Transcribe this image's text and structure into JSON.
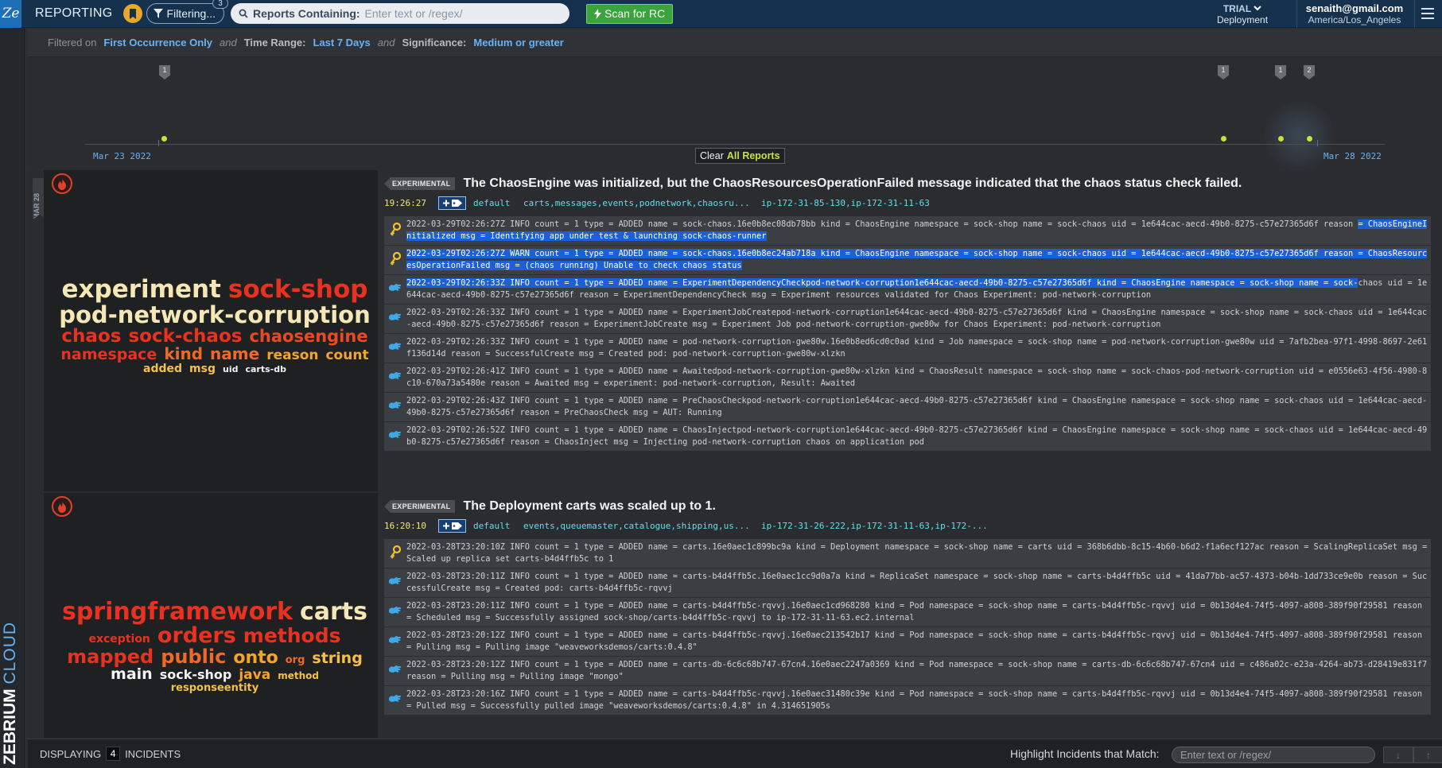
{
  "header": {
    "logo": "Ze",
    "title": "REPORTING",
    "filter_label": "Filtering...",
    "filter_count": "3",
    "search_label": "Reports Containing:",
    "search_placeholder": "Enter text or /regex/",
    "scan_label": "Scan for RC",
    "plan": "TRIAL",
    "deployment": "Deployment",
    "email": "senaith@gmail.com",
    "timezone": "America/Los_Angeles"
  },
  "brand": {
    "bold": "ZEBRIUM",
    "light": "CLOUD"
  },
  "filters": {
    "prefix": "Filtered on",
    "occurrence": "First Occurrence Only",
    "and1": "and",
    "time_key": "Time Range:",
    "time_val": "Last 7 Days",
    "and2": "and",
    "sig_key": "Significance:",
    "sig_val": "Medium or greater"
  },
  "timeline": {
    "start_date": "Mar 23 2022",
    "end_date": "Mar 28 2022",
    "clear_prefix": "Clear",
    "clear_accent": "All Reports",
    "pins": [
      "1",
      "1",
      "1",
      "2"
    ]
  },
  "day_marker": "MAR 28",
  "incidents": [
    {
      "badge": "EXPERIMENTAL",
      "title": "The ChaosEngine was initialized, but the ChaosResourcesOperationFailed message indicated that the chaos status check failed.",
      "time": "19:26:27",
      "namespace": "default",
      "apps": "carts,messages,events,podnetwork,chaosru...",
      "hosts": "ip-172-31-85-130,ip-172-31-11-63",
      "wordcloud": [
        [
          {
            "w": "experiment",
            "c": "#f6e7b6",
            "s": 31
          },
          {
            "w": "sock-shop",
            "c": "#e8321f",
            "s": 31
          }
        ],
        [
          {
            "w": "pod-network-corruption",
            "c": "#f6e7b6",
            "s": 29
          }
        ],
        [
          {
            "w": "chaos",
            "c": "#e8321f",
            "s": 23
          },
          {
            "w": "sock-chaos",
            "c": "#e8321f",
            "s": 23
          },
          {
            "w": "chaosengine",
            "c": "#e84a24",
            "s": 21
          }
        ],
        [
          {
            "w": "namespace",
            "c": "#e8321f",
            "s": 19
          },
          {
            "w": "kind",
            "c": "#ee6a26",
            "s": 20
          },
          {
            "w": "name",
            "c": "#ee6a26",
            "s": 20
          },
          {
            "w": "reason",
            "c": "#f4a62a",
            "s": 17
          },
          {
            "w": "count",
            "c": "#f4a62a",
            "s": 17
          }
        ],
        [
          {
            "w": "added",
            "c": "#f4c04a",
            "s": 14
          },
          {
            "w": "msg",
            "c": "#f4c04a",
            "s": 14
          },
          {
            "w": "uid",
            "c": "#f3f3f3",
            "s": 11
          },
          {
            "w": "carts-db",
            "c": "#f3f3f3",
            "s": 11
          }
        ]
      ],
      "logs": [
        {
          "icon": "key",
          "text": "2022-03-29T02:26:27Z INFO count = 1 type = ADDED name = sock-chaos.16e0b8ec08db78bb kind = ChaosEngine namespace = sock-shop name = sock-chaos uid = 1e644cac-aecd-49b0-8275-c57e27365d6f reason ",
          "hl": "= ChaosEngineInitialized msg = Identifying app under test & launching sock-chaos-runner"
        },
        {
          "icon": "key",
          "text": "2022-03-29T02:26:27Z WARN count = 1 type = ADDED name = sock-chaos.16e0b8ec24ab718a kind = ChaosEngine namespace = sock-shop name = sock-chaos uid = 1e644cac-aecd-49b0-8275-c57e27365d6f reason ",
          "hl": "= ChaosResourcesOperationFailed msg = (chaos running) Unable to check chaos status",
          "all_hl": true
        },
        {
          "icon": "hand",
          "text": "chaos uid = 1e644cac-aecd-49b0-8275-c57e27365d6f reason = ExperimentDependencyCheck msg = Experiment resources validated for Chaos Experiment: pod-network-corruption",
          "lead_hl": "2022-03-29T02:26:33Z INFO count = 1 type = ADDED name = ExperimentDependencyCheckpod-network-corruption1e644cac-aecd-49b0-8275-c57e27365d6f kind = ChaosEngine namespace = sock-shop name = sock-"
        },
        {
          "icon": "hand",
          "text": "2022-03-29T02:26:33Z INFO count = 1 type = ADDED name = ExperimentJobCreatepod-network-corruption1e644cac-aecd-49b0-8275-c57e27365d6f kind = ChaosEngine namespace = sock-shop name = sock-chaos uid = 1e644cac-aecd-49b0-8275-c57e27365d6f reason = ExperimentJobCreate msg = Experiment Job pod-network-corruption-gwe80w for Chaos Experiment: pod-network-corruption"
        },
        {
          "icon": "hand",
          "text": "2022-03-29T02:26:33Z INFO count = 1 type = ADDED name = pod-network-corruption-gwe80w.16e0b8ed6cd0c0ad kind = Job namespace = sock-shop name = pod-network-corruption-gwe80w uid = 7afb2bea-97f1-4998-8697-2e61f136d14d reason = SuccessfulCreate msg = Created pod: pod-network-corruption-gwe80w-xlzkn"
        },
        {
          "icon": "hand",
          "text": "2022-03-29T02:26:41Z INFO count = 1 type = ADDED name = Awaitedpod-network-corruption-gwe80w-xlzkn kind = ChaosResult namespace = sock-shop name = sock-chaos-pod-network-corruption uid = e0556e63-4f56-4980-8c10-670a73a5480e reason = Awaited msg = experiment: pod-network-corruption, Result: Awaited"
        },
        {
          "icon": "hand",
          "text": "2022-03-29T02:26:43Z INFO count = 1 type = ADDED name = PreChaosCheckpod-network-corruption1e644cac-aecd-49b0-8275-c57e27365d6f kind = ChaosEngine namespace = sock-shop name = sock-chaos uid = 1e644cac-aecd-49b0-8275-c57e27365d6f reason = PreChaosCheck msg = AUT: Running"
        },
        {
          "icon": "hand",
          "text": "2022-03-29T02:26:52Z INFO count = 1 type = ADDED name = ChaosInjectpod-network-corruption1e644cac-aecd-49b0-8275-c57e27365d6f kind = ChaosEngine namespace = sock-shop name = sock-chaos uid = 1e644cac-aecd-49b0-8275-c57e27365d6f reason = ChaosInject msg = Injecting pod-network-corruption chaos on application pod"
        }
      ]
    },
    {
      "badge": "EXPERIMENTAL",
      "title": "The Deployment carts was scaled up to 1.",
      "time": "16:20:10",
      "namespace": "default",
      "apps": "events,queuemaster,catalogue,shipping,us...",
      "hosts": "ip-172-31-26-222,ip-172-31-11-63,ip-172-...",
      "wordcloud": [
        [
          {
            "w": "springframework",
            "c": "#e8321f",
            "s": 30
          },
          {
            "w": "carts",
            "c": "#f6e7b6",
            "s": 30
          }
        ],
        [
          {
            "w": "exception",
            "c": "#e8321f",
            "s": 14
          },
          {
            "w": "orders",
            "c": "#e8321f",
            "s": 27
          },
          {
            "w": "methods",
            "c": "#e8321f",
            "s": 25
          }
        ],
        [
          {
            "w": "mapped",
            "c": "#e8321f",
            "s": 24
          },
          {
            "w": "public",
            "c": "#ee6a26",
            "s": 24
          },
          {
            "w": "onto",
            "c": "#f4a62a",
            "s": 22
          },
          {
            "w": "org",
            "c": "#ee6a26",
            "s": 13
          },
          {
            "w": "string",
            "c": "#f4c04a",
            "s": 19
          }
        ],
        [
          {
            "w": "main",
            "c": "#f3f3f3",
            "s": 19
          },
          {
            "w": "sock-shop",
            "c": "#f3f3f3",
            "s": 16
          },
          {
            "w": "java",
            "c": "#f4a62a",
            "s": 17
          },
          {
            "w": "method",
            "c": "#f4c04a",
            "s": 12
          }
        ],
        [
          {
            "w": "responseentity",
            "c": "#f4c04a",
            "s": 13
          }
        ]
      ],
      "logs": [
        {
          "icon": "key",
          "text": "2022-03-28T23:20:10Z INFO count = 1 type = ADDED name = carts.16e0aec1c899bc9a kind = Deployment namespace = sock-shop name = carts uid = 368b6dbb-8c15-4b60-b6d2-f1a6ecf127ac reason = ScalingReplicaSet msg = Scaled up replica set carts-b4d4ffb5c to 1"
        },
        {
          "icon": "hand",
          "text": "2022-03-28T23:20:11Z INFO count = 1 type = ADDED name = carts-b4d4ffb5c.16e0aec1cc9d0a7a kind = ReplicaSet namespace = sock-shop name = carts-b4d4ffb5c uid = 41da77bb-ac57-4373-b04b-1dd733ce9e0b reason = SuccessfulCreate msg = Created pod: carts-b4d4ffb5c-rqvvj"
        },
        {
          "icon": "hand",
          "text": "2022-03-28T23:20:11Z INFO count = 1 type = ADDED name = carts-b4d4ffb5c-rqvvj.16e0aec1cd968280 kind = Pod namespace = sock-shop name = carts-b4d4ffb5c-rqvvj uid = 0b13d4e4-74f5-4097-a808-389f90f29581 reason = Scheduled msg = Successfully assigned sock-shop/carts-b4d4ffb5c-rqvvj to ip-172-31-11-63.ec2.internal"
        },
        {
          "icon": "hand",
          "text": "2022-03-28T23:20:12Z INFO count = 1 type = ADDED name = carts-b4d4ffb5c-rqvvj.16e0aec213542b17 kind = Pod namespace = sock-shop name = carts-b4d4ffb5c-rqvvj uid = 0b13d4e4-74f5-4097-a808-389f90f29581 reason = Pulling msg = Pulling image \"weaveworksdemos/carts:0.4.8\""
        },
        {
          "icon": "hand",
          "text": "2022-03-28T23:20:12Z INFO count = 1 type = ADDED name = carts-db-6c6c68b747-67cn4.16e0aec2247a0369 kind = Pod namespace = sock-shop name = carts-db-6c6c68b747-67cn4 uid = c486a02c-e23a-4264-ab73-d28419e831f7 reason = Pulling msg = Pulling image \"mongo\""
        },
        {
          "icon": "hand",
          "text": "2022-03-28T23:20:16Z INFO count = 1 type = ADDED name = carts-b4d4ffb5c-rqvvj.16e0aec31480c39e kind = Pod namespace = sock-shop name = carts-b4d4ffb5c-rqvvj uid = 0b13d4e4-74f5-4097-a808-389f90f29581 reason = Pulled msg = Successfully pulled image \"weaveworksdemos/carts:0.4.8\" in 4.314651905s"
        }
      ]
    }
  ],
  "footer": {
    "displaying": "DISPLAYING",
    "count": "4",
    "incidents": "INCIDENTS",
    "highlight_label": "Highlight Incidents that Match:",
    "highlight_placeholder": "Enter text or /regex/",
    "down_arrow": "↓",
    "up_arrow": "↑"
  },
  "colors": {
    "accent_blue": "#6cb2f2",
    "lime": "#c6e33a",
    "highlight": "#1d5fd6",
    "topbar": "#16314d"
  }
}
